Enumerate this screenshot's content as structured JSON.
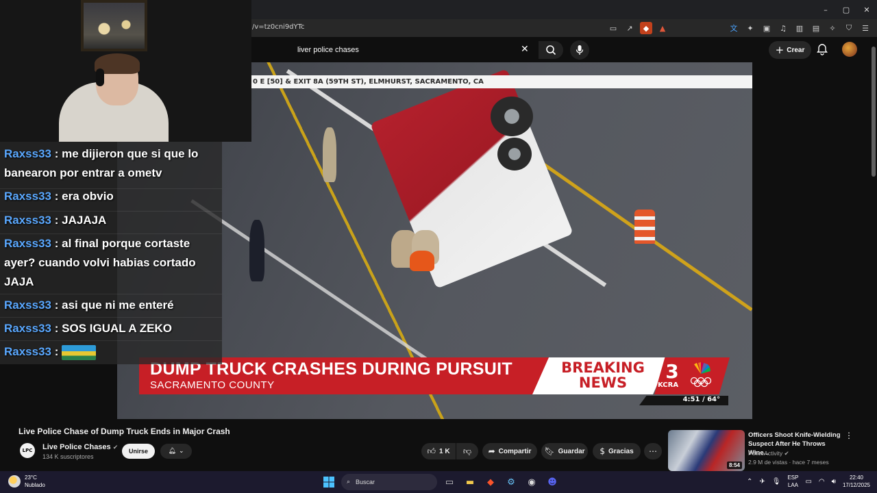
{
  "browser": {
    "url_fragment": "/v=tz0cni9dYTc",
    "window_controls": [
      "–",
      "▢",
      "✕"
    ]
  },
  "youtube": {
    "search_value": "liver police chases",
    "create_label": "Crear"
  },
  "video": {
    "location_banner": "0 E [50] & EXIT 8A (59TH ST), ELMHURST, SACRAMENTO, CA",
    "lower_third_title": "DUMP TRUCK CRASHES DURING PURSUIT",
    "lower_third_sub": "SACRAMENTO COUNTY",
    "breaking_line1": "BREAKING",
    "breaking_line2": "NEWS",
    "station_number": "3",
    "station_name": "KCRA",
    "time_temp": "4:51 / 64°"
  },
  "chat": {
    "messages": [
      {
        "user": "Raxss33",
        "text": ": me dijieron que si que lo banearon por entrar a ometv"
      },
      {
        "user": "Raxss33",
        "text": ": era obvio"
      },
      {
        "user": "Raxss33",
        "text": ": JAJAJA"
      },
      {
        "user": "Raxss33",
        "text": ": al final porque cortaste ayer? cuando volvi habias cortado JAJA"
      },
      {
        "user": "Raxss33",
        "text": ": asi que ni me enteré"
      },
      {
        "user": "Raxss33",
        "text": ": SOS IGUAL A ZEKO"
      },
      {
        "user": "Raxss33",
        "text": ":"
      }
    ]
  },
  "info": {
    "title": "Live Police Chase of Dump Truck Ends in Major Crash",
    "channel_avatar_text": "LPC",
    "channel": "Live Police Chases",
    "subscribers": "134 K suscriptores",
    "join_label": "Unirse",
    "likes": "1 K",
    "share_label": "Compartir",
    "save_label": "Guardar",
    "thanks_label": "Gracias"
  },
  "recommendation": {
    "title": "Officers Shoot Knife-Wielding Suspect After He Throws Wine...",
    "channel": "PoliceActivity",
    "meta": "2.9 M de vistas · hace 7 meses",
    "duration": "8:54"
  },
  "taskbar": {
    "temperature": "23°C",
    "weather": "Nublado",
    "search_label": "Buscar",
    "lang_top": "ESP",
    "lang_bottom": "LAA",
    "time": "22:40",
    "date": "17/12/2025"
  }
}
